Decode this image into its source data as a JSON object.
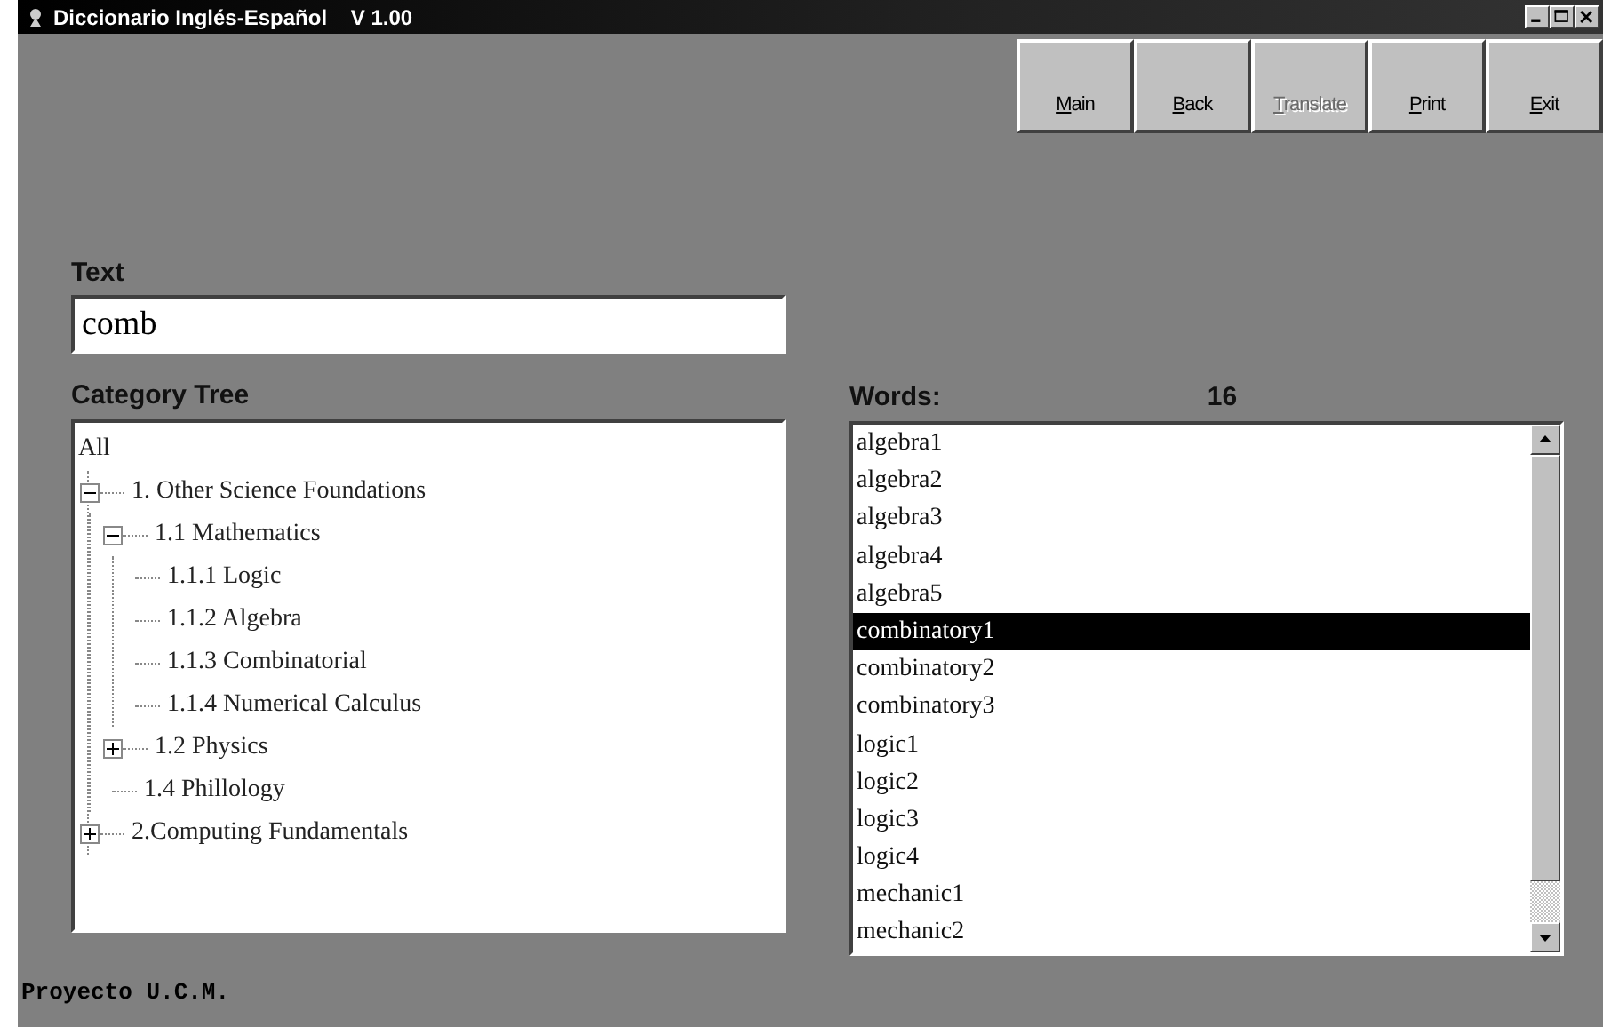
{
  "window": {
    "title": "Diccionario Inglés-Español    V 1.00"
  },
  "toolbar": [
    {
      "label": "Main",
      "disabled": false
    },
    {
      "label": "Back",
      "disabled": false
    },
    {
      "label": "Translate",
      "disabled": true
    },
    {
      "label": "Print",
      "disabled": false
    },
    {
      "label": "Exit",
      "disabled": false
    }
  ],
  "text_field": {
    "label": "Text",
    "value": "comb"
  },
  "category_tree": {
    "label": "Category Tree",
    "root": "All",
    "children": [
      {
        "label": "1. Other Science Foundations",
        "expanded": true,
        "children": [
          {
            "label": "1.1 Mathematics",
            "expanded": true,
            "children": [
              {
                "label": "1.1.1 Logic"
              },
              {
                "label": "1.1.2 Algebra"
              },
              {
                "label": "1.1.3 Combinatorial"
              },
              {
                "label": "1.1.4 Numerical Calculus"
              }
            ]
          },
          {
            "label": "1.2 Physics",
            "expanded": false
          },
          {
            "label": "1.4 Phillology"
          }
        ]
      },
      {
        "label": "2.Computing Fundamentals",
        "expanded": false
      }
    ]
  },
  "words": {
    "label": "Words:",
    "count": "16",
    "items": [
      {
        "text": "algebra1",
        "selected": false
      },
      {
        "text": "algebra2",
        "selected": false
      },
      {
        "text": "algebra3",
        "selected": false
      },
      {
        "text": "algebra4",
        "selected": false
      },
      {
        "text": "algebra5",
        "selected": false
      },
      {
        "text": "combinatory1",
        "selected": true
      },
      {
        "text": "combinatory2",
        "selected": false
      },
      {
        "text": "combinatory3",
        "selected": false
      },
      {
        "text": "logic1",
        "selected": false
      },
      {
        "text": "logic2",
        "selected": false
      },
      {
        "text": "logic3",
        "selected": false
      },
      {
        "text": "logic4",
        "selected": false
      },
      {
        "text": "mechanic1",
        "selected": false
      },
      {
        "text": "mechanic2",
        "selected": false
      }
    ]
  },
  "status": "Proyecto U.C.M."
}
